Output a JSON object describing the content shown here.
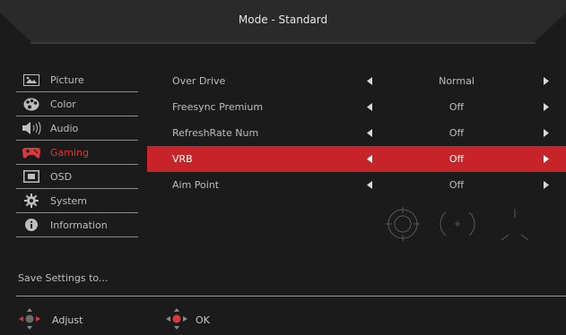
{
  "header": {
    "title": "Mode - Standard"
  },
  "sidebar": {
    "items": [
      {
        "label": "Picture",
        "icon": "picture-icon",
        "active": false
      },
      {
        "label": "Color",
        "icon": "palette-icon",
        "active": false
      },
      {
        "label": "Audio",
        "icon": "speaker-icon",
        "active": false
      },
      {
        "label": "Gaming",
        "icon": "gamepad-icon",
        "active": true
      },
      {
        "label": "OSD",
        "icon": "osd-icon",
        "active": false
      },
      {
        "label": "System",
        "icon": "gear-icon",
        "active": false
      },
      {
        "label": "Information",
        "icon": "info-icon",
        "active": false
      }
    ],
    "save_label": "Save Settings to..."
  },
  "settings": {
    "rows": [
      {
        "label": "Over Drive",
        "value": "Normal",
        "selected": false
      },
      {
        "label": "Freesync Premium",
        "value": "Off",
        "selected": false
      },
      {
        "label": "RefreshRate Num",
        "value": "Off",
        "selected": false
      },
      {
        "label": "VRB",
        "value": "Off",
        "selected": true
      },
      {
        "label": "Aim Point",
        "value": "Off",
        "selected": false
      }
    ]
  },
  "footer": {
    "adjust_label": "Adjust",
    "ok_label": "OK"
  },
  "colors": {
    "accent": "#c7242a",
    "background": "#1b1b1b",
    "text": "#bdbdbd"
  }
}
